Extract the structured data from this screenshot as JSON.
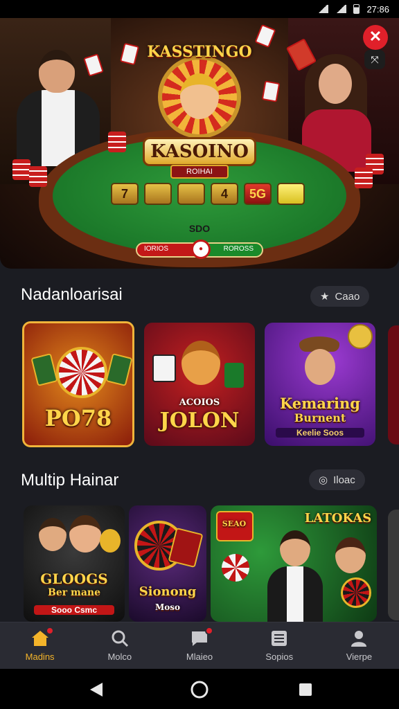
{
  "status": {
    "time": "27:86"
  },
  "hero": {
    "logo_top": "KASSTINGO",
    "logo_main": "KASOINO",
    "logo_sub": "ROIHAI",
    "tiles": [
      "7",
      "",
      "",
      "4",
      "5G",
      ""
    ],
    "felt_label": "SDO",
    "bar_left": "IORIOS",
    "bar_center": "●",
    "bar_right": "ROROSS",
    "close_icon": "✕",
    "share_icon": "⤧"
  },
  "section1": {
    "title": "Nadanloarisai",
    "pill_label": "Caao",
    "cards": [
      {
        "label": "PO78",
        "sub": ""
      },
      {
        "label": "JOLON",
        "sub": "ACOIOS"
      },
      {
        "label": "Kemaring",
        "sub": "Burnent",
        "tag": "Keelie Soos"
      }
    ]
  },
  "section2": {
    "title": "Multip Hainar",
    "pill_label": "Iloac",
    "cards": [
      {
        "label": "GLOOGS",
        "sub": "Ber mane",
        "tag": "Sooo Csmc"
      },
      {
        "label": "Sionong",
        "sub": "Moso"
      },
      {
        "label": "LATOKAS",
        "sub": "SEAO"
      }
    ]
  },
  "nav": [
    {
      "label": "Madins",
      "icon": "home-icon",
      "active": true,
      "badge": true
    },
    {
      "label": "Molco",
      "icon": "search-icon",
      "active": false,
      "badge": false
    },
    {
      "label": "Mlaieo",
      "icon": "chat-icon",
      "active": false,
      "badge": true
    },
    {
      "label": "Sopios",
      "icon": "list-icon",
      "active": false,
      "badge": false
    },
    {
      "label": "Vierpe",
      "icon": "profile-icon",
      "active": false,
      "badge": false
    }
  ],
  "colors": {
    "accent": "#f4b42a",
    "badge": "#e0202a",
    "bg": "#1b1c22",
    "nav_bg": "#2a2b33"
  }
}
